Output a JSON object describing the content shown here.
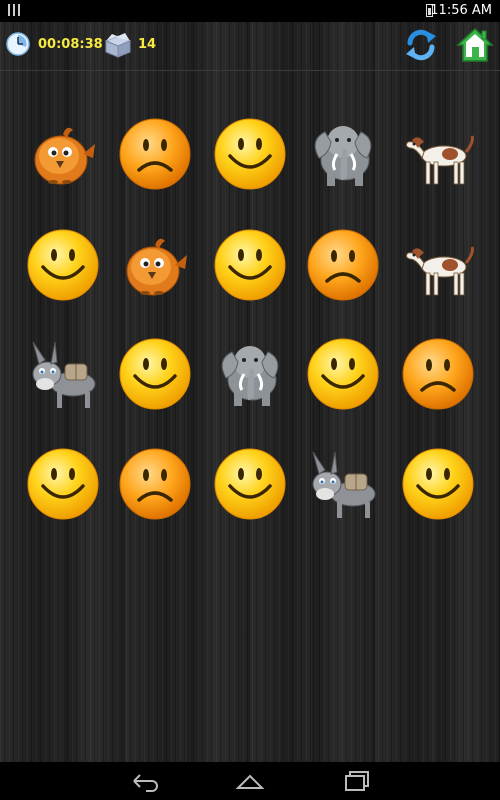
{
  "status_bar": {
    "time": "11:56 AM"
  },
  "hud": {
    "timer": "00:08:38",
    "moves": "14"
  },
  "icons": {
    "timer": "clock-icon",
    "moves": "box-icon",
    "restart": "refresh-icon",
    "home": "home-icon",
    "back": "back-icon",
    "home_nav": "home-outline-icon",
    "recents": "recents-icon"
  },
  "colors": {
    "hud_text": "#f5e942",
    "smiley_face": "#ffd21a",
    "sad_face": "#ffa51c",
    "home_green": "#3bb54a",
    "refresh_blue": "#2a8ee0"
  },
  "grid": {
    "rows": [
      [
        "bird",
        "sad",
        "happy",
        "elephant",
        "dog"
      ],
      [
        "happy",
        "bird",
        "happy",
        "sad",
        "dog"
      ],
      [
        "donkey",
        "happy",
        "elephant",
        "happy",
        "sad"
      ],
      [
        "happy",
        "sad",
        "happy",
        "donkey",
        "happy"
      ]
    ]
  }
}
